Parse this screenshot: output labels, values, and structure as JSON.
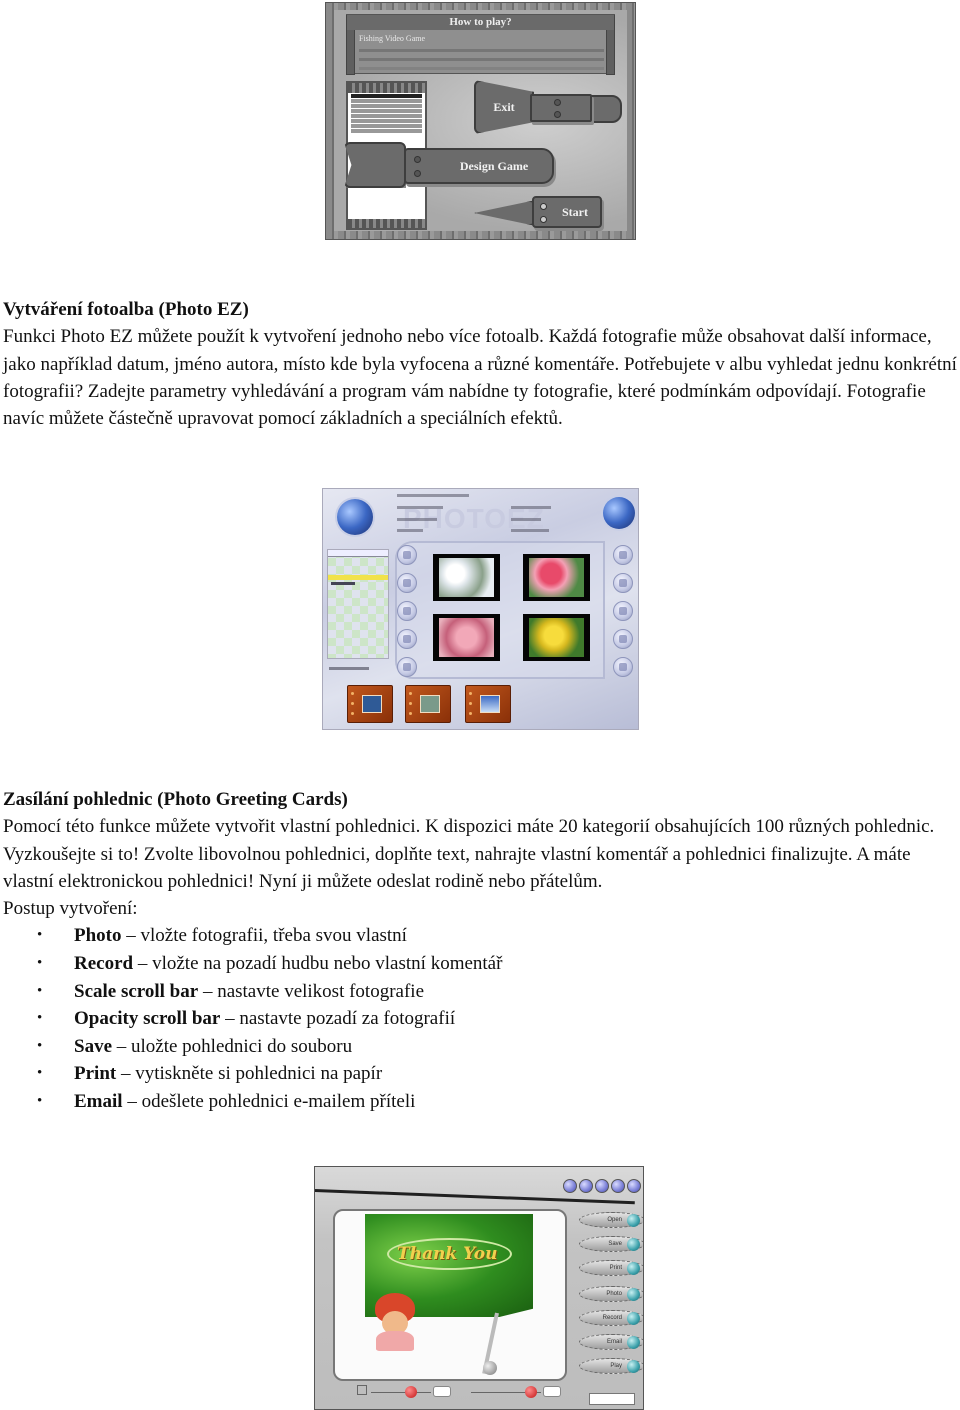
{
  "figures": {
    "fishing_game": {
      "title": "How to play?",
      "subtitle": "Fishing Video Game",
      "buttons": [
        "Exit",
        "Design Game",
        "Start"
      ]
    },
    "photo_ez": {
      "watermark": "PHOTOEZ"
    },
    "greeting_card": {
      "card_text": "Thank You",
      "side_buttons": [
        "Open",
        "Save",
        "Print",
        "Photo",
        "Record",
        "Email",
        "Play"
      ]
    }
  },
  "section_photo_ez": {
    "heading": "Vytváření fotoalba (Photo EZ)",
    "body": "Funkci Photo EZ můžete použít k vytvoření jednoho nebo více fotoalb. Každá fotografie může obsahovat další informace, jako například datum, jméno autora, místo kde byla vyfocena a různé komentáře. Potřebujete v albu vyhledat jednu konkrétní fotografii? Zadejte parametry vyhledávání a program vám nabídne ty fotografie, které podmínkám odpovídají. Fotografie navíc můžete částečně upravovat pomocí základních a speciálních efektů."
  },
  "section_greeting_cards": {
    "heading": "Zasílání pohlednic (Photo Greeting Cards)",
    "body": "Pomocí této funkce můžete vytvořit vlastní pohlednici. K dispozici máte 20 kategorií obsahujících 100 různých pohlednic. Vyzkoušejte si to! Zvolte libovolnou pohlednici, doplňte text, nahrajte vlastní komentář a pohlednici finalizujte. A máte vlastní elektronickou pohlednici! Nyní ji můžete odeslat rodině nebo přátelům.",
    "steps_intro": "Postup vytvoření:",
    "bullet": "•",
    "steps": [
      {
        "term": "Photo",
        "desc": " – vložte fotografii, třeba svou vlastní"
      },
      {
        "term": "Record",
        "desc": " – vložte na pozadí hudbu nebo vlastní komentář"
      },
      {
        "term": "Scale scroll bar",
        "desc": " – nastavte velikost fotografie"
      },
      {
        "term": "Opacity scroll bar",
        "desc": " – nastavte pozadí za fotografií"
      },
      {
        "term": "Save",
        "desc": " – uložte pohlednici do souboru"
      },
      {
        "term": "Print",
        "desc": " – vytiskněte si pohlednici na papír"
      },
      {
        "term": "Email",
        "desc": " – odešlete pohlednici e-mailem příteli"
      }
    ]
  }
}
